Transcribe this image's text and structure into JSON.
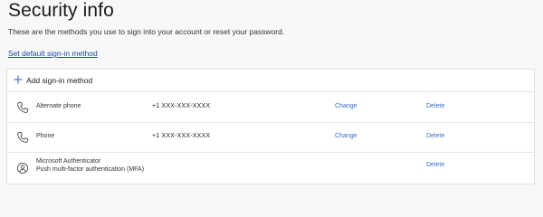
{
  "page": {
    "title": "Security info",
    "subtitle": "These are the methods you use to sign into your account or reset your password.",
    "default_link": "Set default sign-in method"
  },
  "card": {
    "add_label": "Add sign-in method",
    "methods": [
      {
        "icon": "phone-icon",
        "name": "Alternate phone",
        "detail": "+1 XXX-XXX-XXXX",
        "change": "Change",
        "delete": "Delete"
      },
      {
        "icon": "phone-icon",
        "name": "Phone",
        "detail": "+1 XXX-XXX-XXXX",
        "change": "Change",
        "delete": "Delete"
      },
      {
        "icon": "authenticator-icon",
        "name": "Microsoft Authenticator",
        "subname": "Push multi-factor authentication (MFA)",
        "delete": "Delete"
      }
    ]
  },
  "colors": {
    "link": "#3a6cc7",
    "link_dark": "#1e4aa0",
    "text": "#1b1b1b",
    "border": "#e1e1e1",
    "background": "#f8f8f8"
  }
}
